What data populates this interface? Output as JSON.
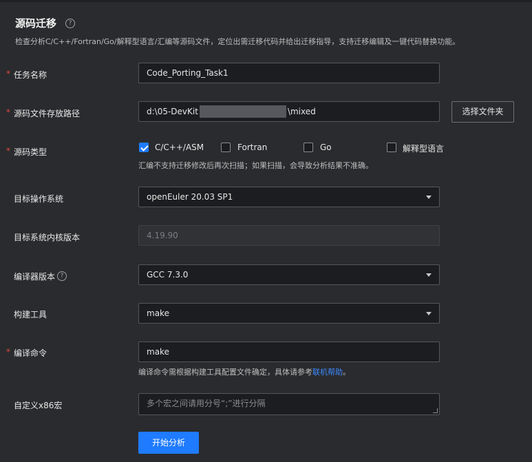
{
  "header": {
    "title": "源码迁移",
    "description": "检查分析C/C++/Fortran/Go/解释型语言/汇编等源码文件，定位出需迁移代码并给出迁移指导，支持迁移编辑及一键代码替换功能。"
  },
  "form": {
    "task_name": {
      "label": "任务名称",
      "value": "Code_Porting_Task1"
    },
    "source_path": {
      "label": "源码文件存放路径",
      "value_prefix": "d:\\05-DevKit",
      "value_suffix": "\\mixed",
      "browse_label": "选择文件夹"
    },
    "source_type": {
      "label": "源码类型",
      "options": [
        {
          "label": "C/C++/ASM",
          "checked": true
        },
        {
          "label": "Fortran",
          "checked": false
        },
        {
          "label": "Go",
          "checked": false
        },
        {
          "label": "解释型语言",
          "checked": false
        }
      ],
      "hint": "汇编不支持迁移修改后再次扫描；如果扫描，会导致分析结果不准确。"
    },
    "target_os": {
      "label": "目标操作系统",
      "value": "openEuler 20.03 SP1"
    },
    "kernel_version": {
      "label": "目标系统内核版本",
      "value": "4.19.90"
    },
    "compiler_version": {
      "label": "编译器版本",
      "value": "GCC 7.3.0"
    },
    "build_tool": {
      "label": "构建工具",
      "value": "make"
    },
    "compile_command": {
      "label": "编译命令",
      "value": "make",
      "hint_prefix": "编译命令需根据构建工具配置文件确定，具体请参考",
      "hint_link": "联机帮助",
      "hint_suffix": "。"
    },
    "custom_macro": {
      "label": "自定义x86宏",
      "placeholder": "多个宏之间请用分号“;”进行分隔"
    },
    "submit_label": "开始分析"
  },
  "icons": {
    "help": "question-circle-icon",
    "dropdown": "caret-down-icon",
    "checkbox": "check-icon"
  },
  "colors": {
    "accent": "#1f7bff",
    "required": "#e0483e",
    "background": "#2a2b2e"
  }
}
